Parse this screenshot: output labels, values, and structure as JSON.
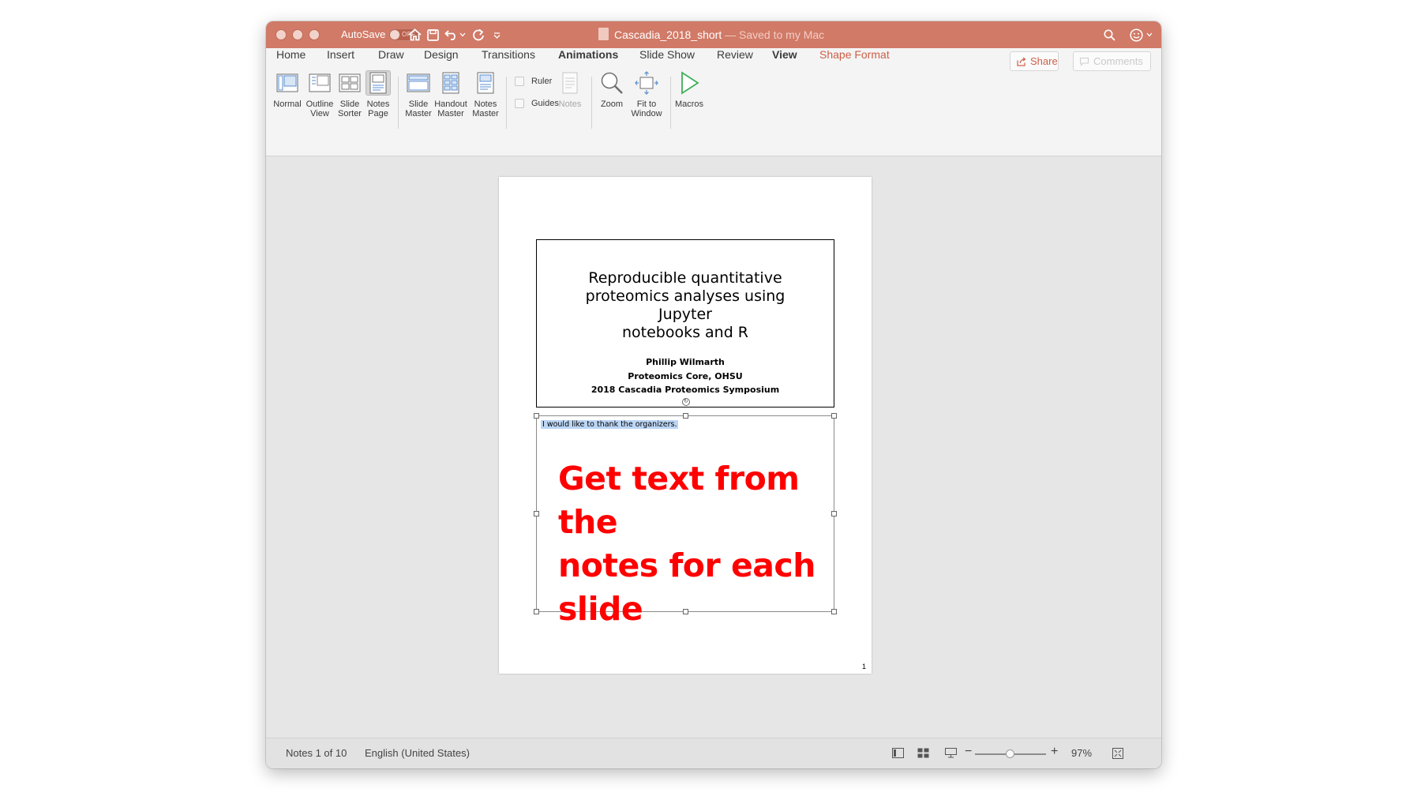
{
  "window": {
    "autosave_label": "AutoSave",
    "autosave_state": "OFF",
    "doc_name": "Cascadia_2018_short",
    "doc_status": "— Saved to my Mac"
  },
  "tabs": [
    {
      "label": "Home"
    },
    {
      "label": "Insert"
    },
    {
      "label": "Draw"
    },
    {
      "label": "Design"
    },
    {
      "label": "Transitions"
    },
    {
      "label": "Animations"
    },
    {
      "label": "Slide Show"
    },
    {
      "label": "Review"
    },
    {
      "label": "View"
    },
    {
      "label": "Shape Format"
    }
  ],
  "top_buttons": {
    "share": "Share",
    "comments": "Comments"
  },
  "ribbon": {
    "normal": [
      "Normal",
      ""
    ],
    "outline": [
      "Outline",
      "View"
    ],
    "sorter": [
      "Slide",
      "Sorter"
    ],
    "notes_page": [
      "Notes",
      "Page"
    ],
    "slide_master": [
      "Slide",
      "Master"
    ],
    "handout_master": [
      "Handout",
      "Master"
    ],
    "notes_master": [
      "Notes",
      "Master"
    ],
    "ruler": "Ruler",
    "guides": "Guides",
    "notes": "Notes",
    "zoom": "Zoom",
    "fit": [
      "Fit to",
      "Window"
    ],
    "macros": "Macros"
  },
  "slide": {
    "title_lines": [
      "Reproducible quantitative",
      "proteomics analyses using Jupyter",
      "notebooks and R"
    ],
    "subtitle_lines": [
      "Phillip Wilmarth",
      "Proteomics Core, OHSU",
      "2018 Cascadia Proteomics Symposium"
    ]
  },
  "notes": {
    "text": "I would like to thank the organizers.",
    "overlay_lines": [
      "Get text from the",
      "notes for each",
      "slide"
    ],
    "page_number": "1"
  },
  "status": {
    "notes_position": "Notes 1 of 10",
    "language": "English (United States)",
    "zoom_level": "97%",
    "zoom_fraction": 0.5
  },
  "colors": {
    "titlebar": "#d17a67",
    "accent": "#cc5f47",
    "overlay_text": "#ff0000",
    "selection": "#bcd6f5"
  }
}
